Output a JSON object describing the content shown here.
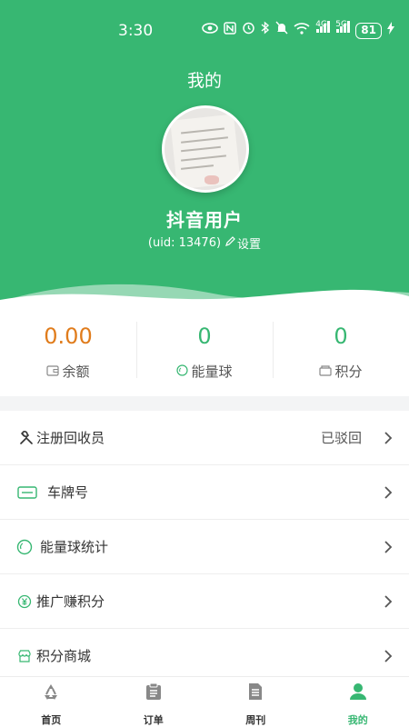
{
  "status_bar": {
    "time": "3:30",
    "battery": "81",
    "network": [
      "4G",
      "5G"
    ]
  },
  "header": {
    "title": "我的",
    "username": "抖音用户",
    "uid_text": "(uid: 13476)",
    "settings_label": "设置"
  },
  "stats": [
    {
      "value": "0.00",
      "label": "余额",
      "icon": "wallet-icon",
      "color": "#e07c1c"
    },
    {
      "value": "0",
      "label": "能量球",
      "icon": "energy-ball-icon",
      "color": "#37b772"
    },
    {
      "value": "0",
      "label": "积分",
      "icon": "points-icon",
      "color": "#37b772"
    }
  ],
  "menu": [
    {
      "label": "注册回收员",
      "status": "已驳回",
      "icon": "tools-icon"
    },
    {
      "label": "车牌号",
      "status": "",
      "icon": "license-plate-icon"
    },
    {
      "label": "能量球统计",
      "status": "",
      "icon": "energy-ball-icon"
    },
    {
      "label": "推广赚积分",
      "status": "",
      "icon": "yuan-coin-icon"
    },
    {
      "label": "积分商城",
      "status": "",
      "icon": "store-icon"
    }
  ],
  "tabs": [
    {
      "label": "首页",
      "icon": "recycle-icon",
      "active": false
    },
    {
      "label": "订单",
      "icon": "clipboard-icon",
      "active": false
    },
    {
      "label": "周刊",
      "icon": "document-icon",
      "active": false
    },
    {
      "label": "我的",
      "icon": "user-icon",
      "active": true
    }
  ],
  "colors": {
    "brand_green": "#37b772",
    "balance_orange": "#e07c1c",
    "inactive_icon": "#888888"
  }
}
